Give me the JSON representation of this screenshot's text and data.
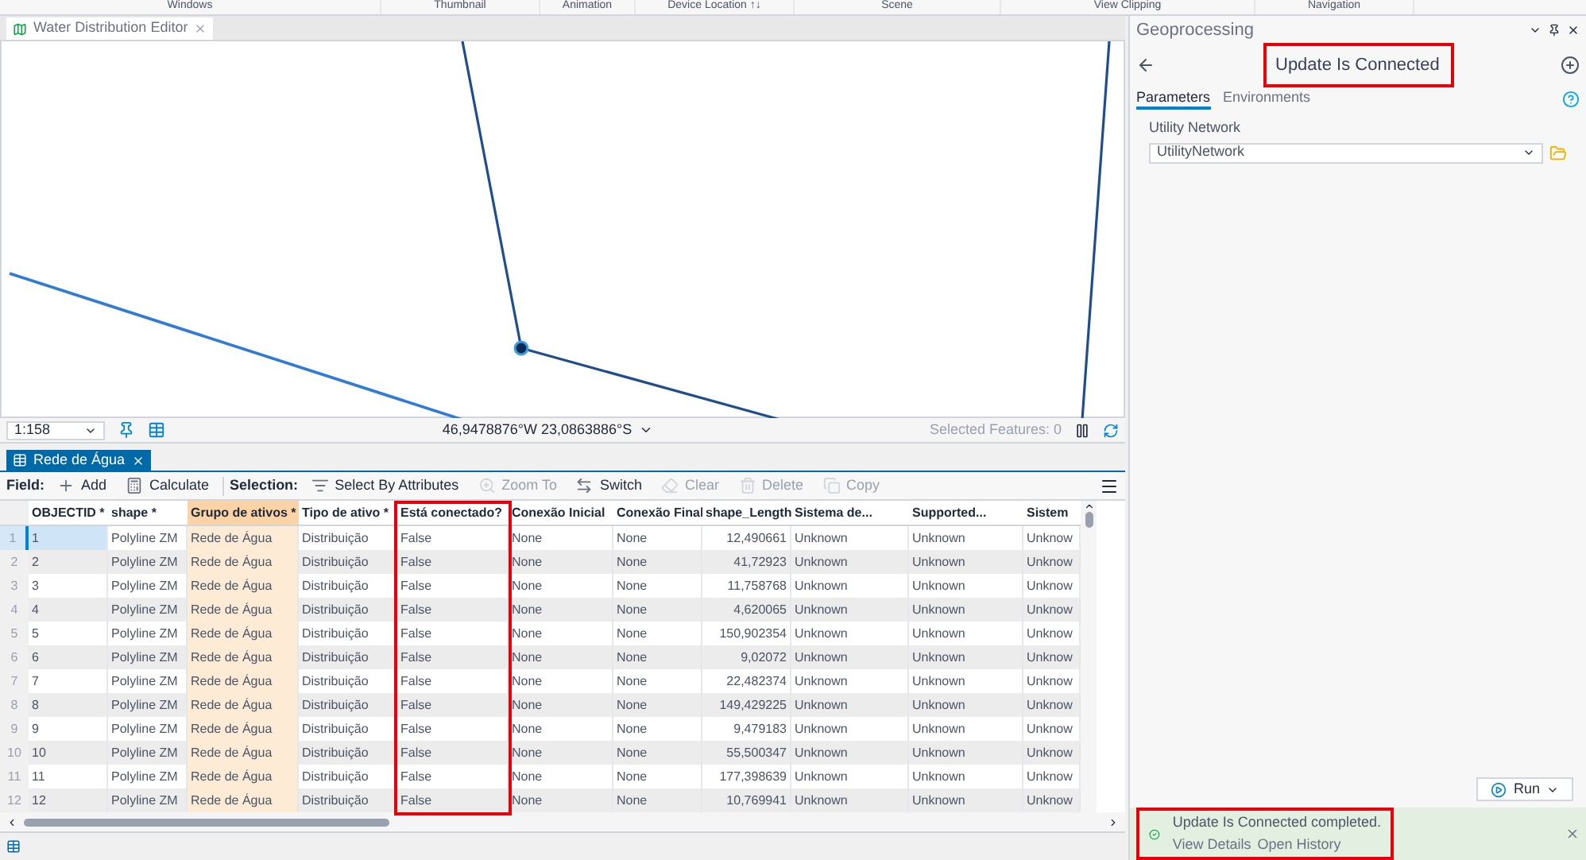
{
  "ribbon_groups": [
    "Windows",
    "Thumbnail",
    "Animation",
    "Device Location ↑↓",
    "Scene",
    "View Clipping",
    "Navigation"
  ],
  "map_view": {
    "tab": {
      "label": "Water Distribution Editor",
      "selected": true
    },
    "scale": "1:158",
    "coordinates": "46,9478876°W 23,0863886°S",
    "selected_features": "Selected Features: 0"
  },
  "table_view": {
    "tab": {
      "label": "Rede de Água",
      "selected": true
    },
    "toolbar": {
      "field_label": "Field:",
      "field_tools": [
        {
          "label": "Add",
          "disabled": false
        },
        {
          "label": "Calculate",
          "disabled": false
        }
      ],
      "selection_label": "Selection:",
      "selection_tools": [
        {
          "label": "Select By Attributes",
          "disabled": false
        },
        {
          "label": "Zoom To",
          "disabled": true
        },
        {
          "label": "Switch",
          "disabled": false
        },
        {
          "label": "Clear",
          "disabled": true
        },
        {
          "label": "Delete",
          "disabled": true
        },
        {
          "label": "Copy",
          "disabled": true
        }
      ]
    },
    "columns": [
      {
        "label": "OBJECTID *",
        "selected": false,
        "kind": "text"
      },
      {
        "label": "shape *",
        "selected": false,
        "kind": "text"
      },
      {
        "label": "Grupo de ativos *",
        "selected": true,
        "kind": "text"
      },
      {
        "label": "Tipo de ativo *",
        "selected": false,
        "kind": "text"
      },
      {
        "label": "Está conectado?",
        "selected": false,
        "kind": "text"
      },
      {
        "label": "Conexão Inicial",
        "selected": false,
        "kind": "text"
      },
      {
        "label": "Conexão Final",
        "selected": false,
        "kind": "text"
      },
      {
        "label": "shape_Length",
        "selected": false,
        "kind": "number"
      },
      {
        "label": "Sistema de...",
        "selected": false,
        "kind": "text"
      },
      {
        "label": "Supported...",
        "selected": false,
        "kind": "text"
      },
      {
        "label": "Sistem",
        "selected": false,
        "kind": "text"
      }
    ],
    "rows": [
      {
        "number": "1",
        "selected": true,
        "cells": [
          "1",
          "Polyline ZM",
          "Rede de Água",
          "Distribuição",
          "False",
          "None",
          "None",
          "12,490661",
          "Unknown",
          "Unknown",
          "Unknow"
        ]
      },
      {
        "number": "2",
        "selected": false,
        "cells": [
          "2",
          "Polyline ZM",
          "Rede de Água",
          "Distribuição",
          "False",
          "None",
          "None",
          "41,72923",
          "Unknown",
          "Unknown",
          "Unknow"
        ]
      },
      {
        "number": "3",
        "selected": false,
        "cells": [
          "3",
          "Polyline ZM",
          "Rede de Água",
          "Distribuição",
          "False",
          "None",
          "None",
          "11,758768",
          "Unknown",
          "Unknown",
          "Unknow"
        ]
      },
      {
        "number": "4",
        "selected": false,
        "cells": [
          "4",
          "Polyline ZM",
          "Rede de Água",
          "Distribuição",
          "False",
          "None",
          "None",
          "4,620065",
          "Unknown",
          "Unknown",
          "Unknow"
        ]
      },
      {
        "number": "5",
        "selected": false,
        "cells": [
          "5",
          "Polyline ZM",
          "Rede de Água",
          "Distribuição",
          "False",
          "None",
          "None",
          "150,902354",
          "Unknown",
          "Unknown",
          "Unknow"
        ]
      },
      {
        "number": "6",
        "selected": false,
        "cells": [
          "6",
          "Polyline ZM",
          "Rede de Água",
          "Distribuição",
          "False",
          "None",
          "None",
          "9,02072",
          "Unknown",
          "Unknown",
          "Unknow"
        ]
      },
      {
        "number": "7",
        "selected": false,
        "cells": [
          "7",
          "Polyline ZM",
          "Rede de Água",
          "Distribuição",
          "False",
          "None",
          "None",
          "22,482374",
          "Unknown",
          "Unknown",
          "Unknow"
        ]
      },
      {
        "number": "8",
        "selected": false,
        "cells": [
          "8",
          "Polyline ZM",
          "Rede de Água",
          "Distribuição",
          "False",
          "None",
          "None",
          "149,429225",
          "Unknown",
          "Unknown",
          "Unknow"
        ]
      },
      {
        "number": "9",
        "selected": false,
        "cells": [
          "9",
          "Polyline ZM",
          "Rede de Água",
          "Distribuição",
          "False",
          "None",
          "None",
          "9,479183",
          "Unknown",
          "Unknown",
          "Unknow"
        ]
      },
      {
        "number": "10",
        "selected": false,
        "cells": [
          "10",
          "Polyline ZM",
          "Rede de Água",
          "Distribuição",
          "False",
          "None",
          "None",
          "55,500347",
          "Unknown",
          "Unknown",
          "Unknow"
        ]
      },
      {
        "number": "11",
        "selected": false,
        "cells": [
          "11",
          "Polyline ZM",
          "Rede de Água",
          "Distribuição",
          "False",
          "None",
          "None",
          "177,398639",
          "Unknown",
          "Unknown",
          "Unknow"
        ]
      },
      {
        "number": "12",
        "selected": false,
        "cells": [
          "12",
          "Polyline ZM",
          "Rede de Água",
          "Distribuição",
          "False",
          "None",
          "None",
          "10,769941",
          "Unknown",
          "Unknown",
          "Unknow"
        ]
      }
    ]
  },
  "geoprocessing": {
    "title": "Geoprocessing",
    "tool_title": "Update Is Connected",
    "tabs": [
      {
        "label": "Parameters",
        "selected": true
      },
      {
        "label": "Environments",
        "selected": false
      }
    ],
    "parameter": {
      "label": "Utility Network",
      "value": "UtilityNetwork"
    },
    "run_button": "Run",
    "notification": {
      "message": "Update Is Connected completed.",
      "links": [
        "View Details",
        "Open History"
      ]
    }
  }
}
